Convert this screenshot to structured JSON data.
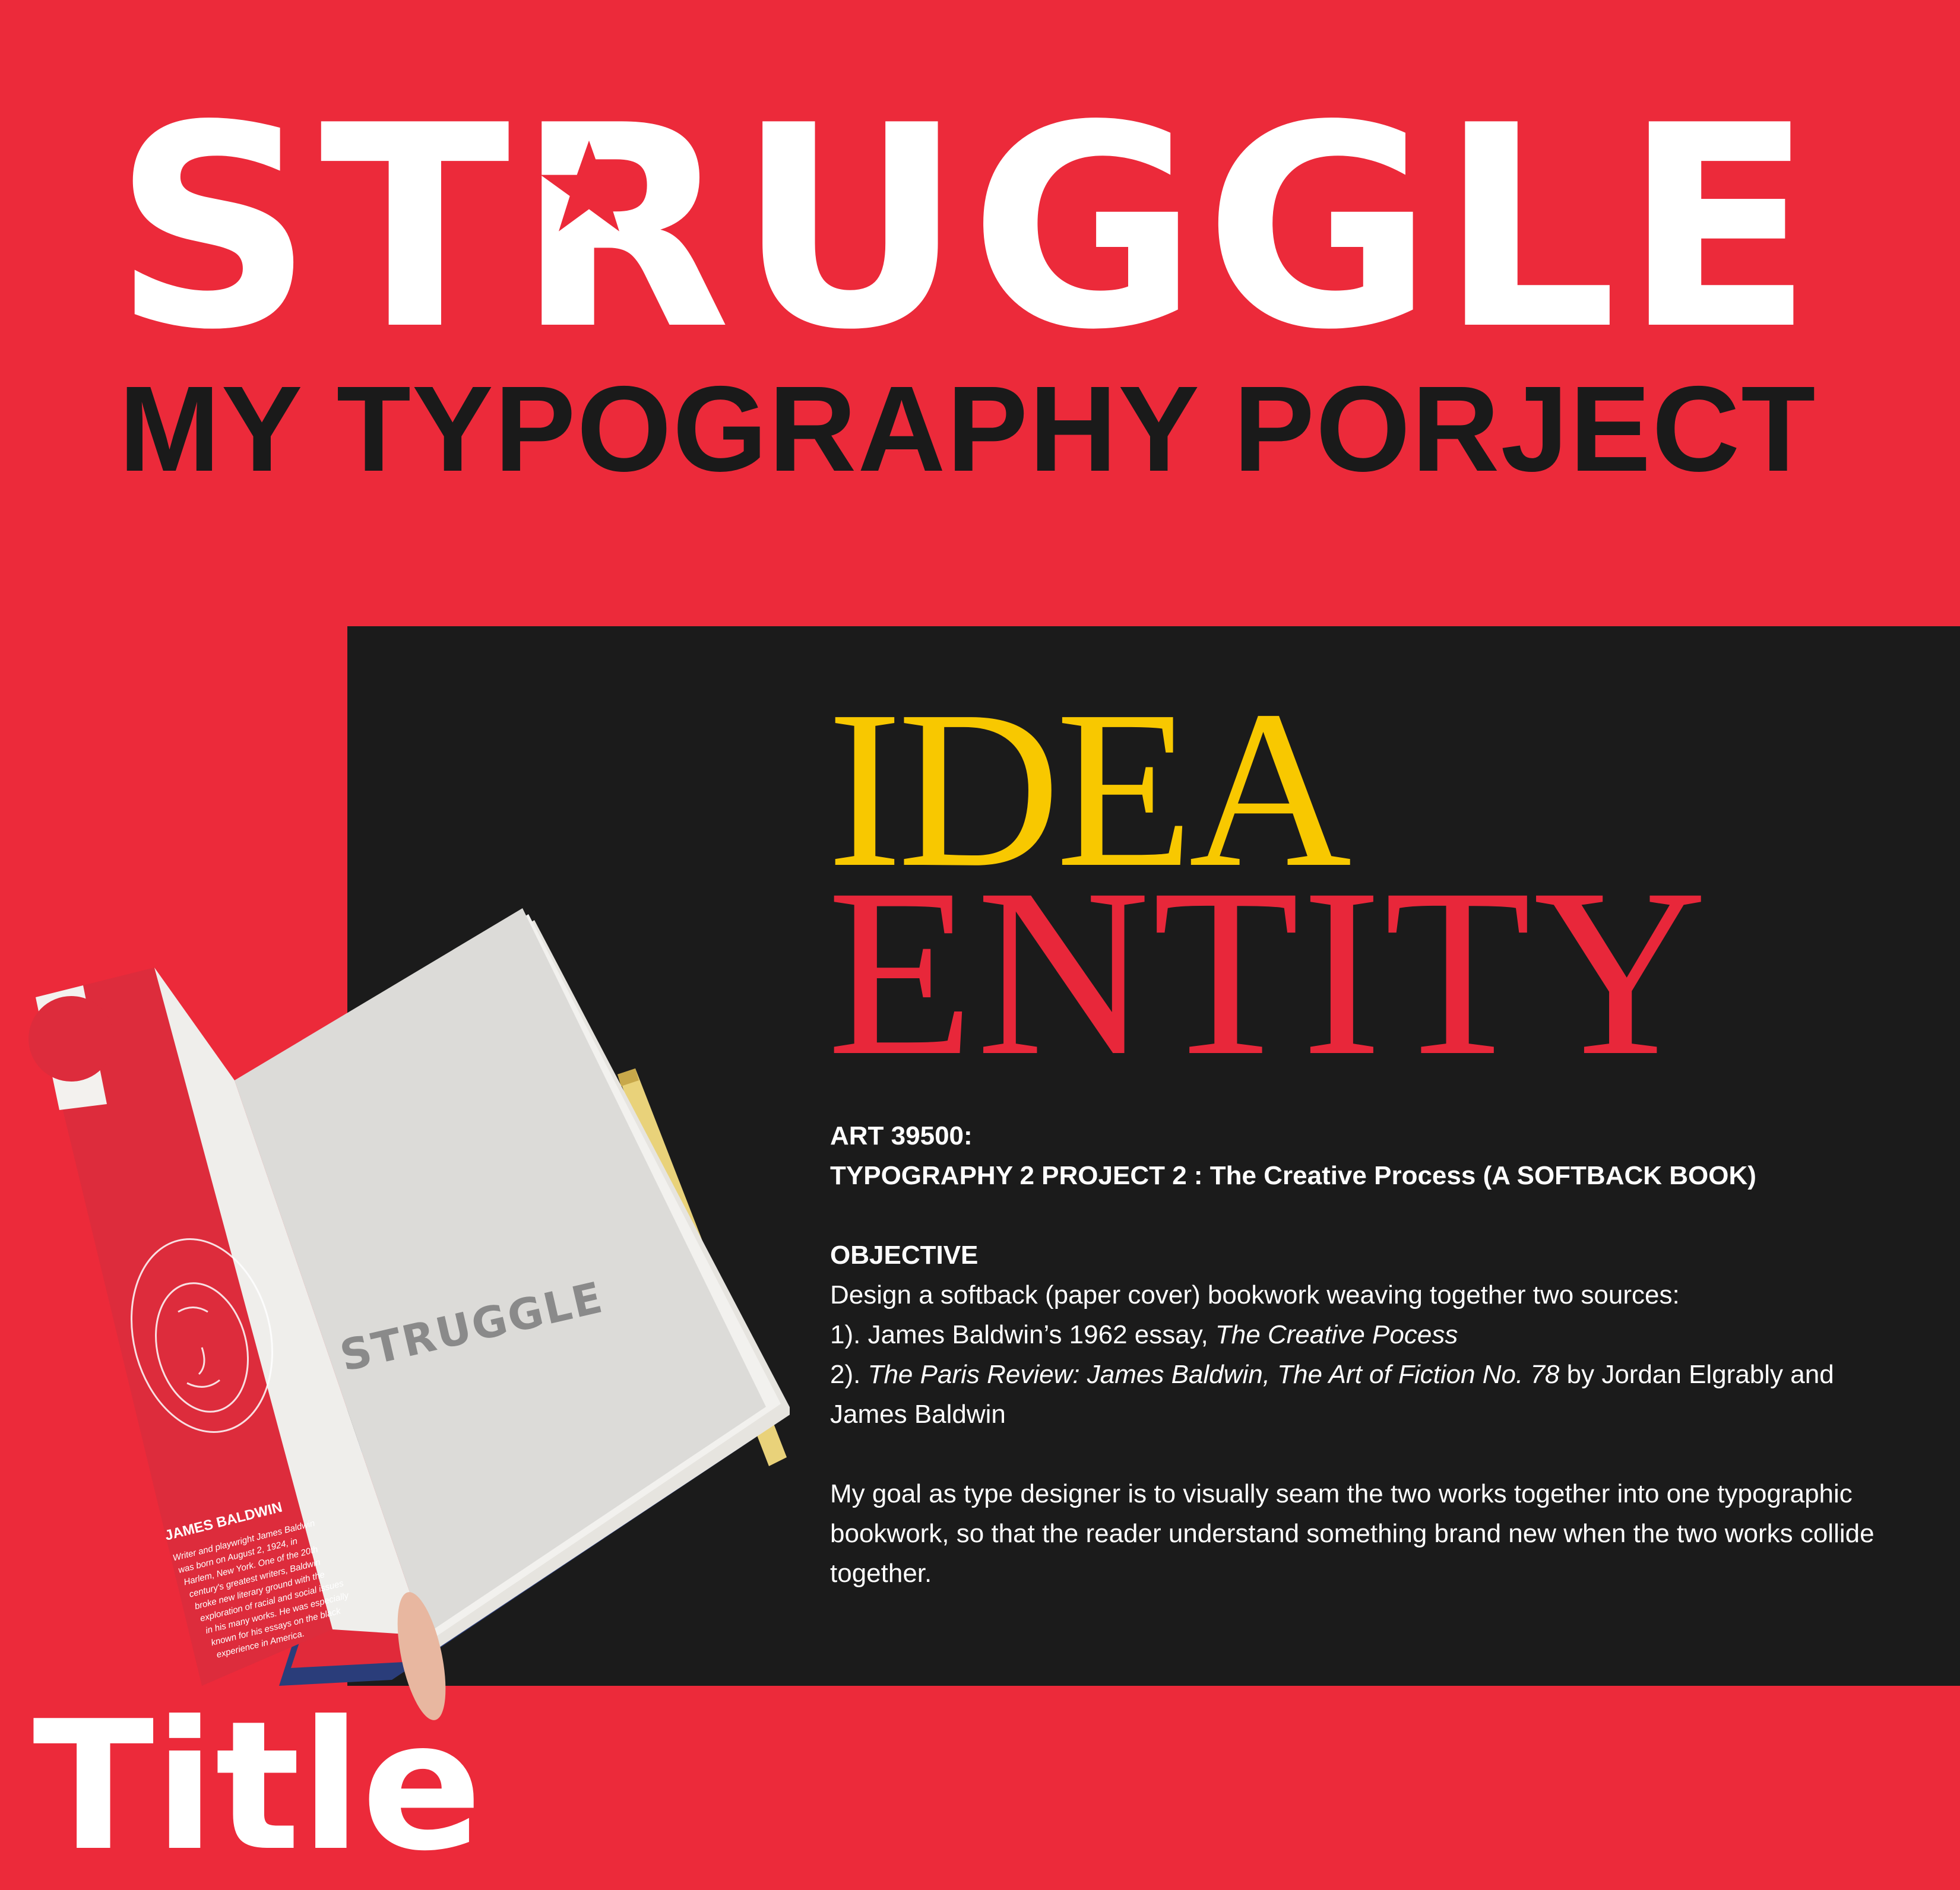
{
  "header": {
    "title_before_star": "ST",
    "title_star_letter": "R",
    "title_after_star": "UGGLE",
    "subtitle": "MY TYPOGRAPHY PORJECT"
  },
  "idea_block": {
    "word_1": "IDEA",
    "word_2": "ENTITY"
  },
  "brief": {
    "course": "ART 39500:",
    "project": "TYPOGRAPHY 2 PROJECT 2 : The Creative Process (A SOFTBACK BOOK)",
    "objective_heading": "OBJECTIVE",
    "objective_intro": "Design a softback (paper cover) bookwork weaving together two sources:",
    "source_1_prefix": "1). James Baldwin’s 1962 essay, ",
    "source_1_title": "The Creative Pocess",
    "source_2_prefix": "2). ",
    "source_2_title": "The Paris Review: James Baldwin, The Art of Fiction No. 78",
    "source_2_suffix": " by Jordan Elgrably and James Baldwin",
    "goal": "My goal as type designer is to visually seam the two works together into one typographic bookwork, so that the reader understand something brand new when the two works collide together."
  },
  "book_photo": {
    "page_title": "STRUGGLE",
    "spine_name": "JAMES BALDWIN",
    "spine_bio": "Writer and playwright James Baldwin was born on August 2, 1924, in Harlem, New York. One of the 20th century's greatest writers, Baldwin broke new literary ground with the exploration of racial and social issues in his many works. He was especially known for his essays on the black experience in America."
  },
  "footer": {
    "section_title": "Title"
  },
  "colors": {
    "background": "#ec2a3a",
    "panel": "#1b1b1b",
    "idea": "#f8c800",
    "entity": "#e8273a",
    "subtitle": "#1a1a1a",
    "white": "#ffffff"
  }
}
